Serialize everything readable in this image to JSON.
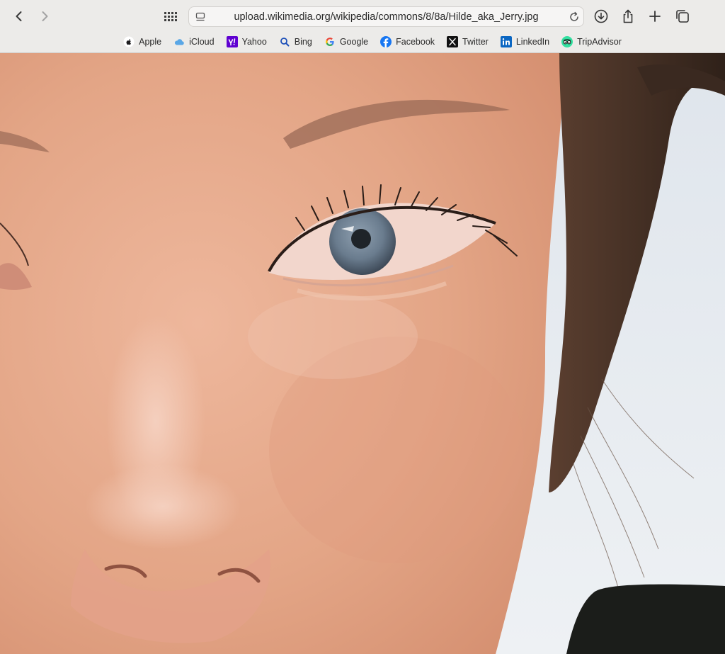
{
  "toolbar": {
    "url": "upload.wikimedia.org/wikipedia/commons/8/8a/Hilde_aka_Jerry.jpg",
    "back_icon": "chevron-left-icon",
    "forward_icon": "chevron-right-icon",
    "tab_grid_icon": "grid-icon",
    "page_icon": "page-settings-icon",
    "reload_icon": "reload-icon",
    "download_icon": "download-icon",
    "share_icon": "share-icon",
    "new_tab_icon": "plus-icon",
    "tabs_overview_icon": "tabs-icon"
  },
  "bookmarks": [
    {
      "label": "Apple",
      "icon": "apple-icon"
    },
    {
      "label": "iCloud",
      "icon": "icloud-icon"
    },
    {
      "label": "Yahoo",
      "icon": "yahoo-icon"
    },
    {
      "label": "Bing",
      "icon": "bing-icon"
    },
    {
      "label": "Google",
      "icon": "google-icon"
    },
    {
      "label": "Facebook",
      "icon": "facebook-icon"
    },
    {
      "label": "Twitter",
      "icon": "twitter-x-icon"
    },
    {
      "label": "LinkedIn",
      "icon": "linkedin-icon"
    },
    {
      "label": "TripAdvisor",
      "icon": "tripadvisor-icon"
    }
  ],
  "colors": {
    "chrome_bg": "#ecebe9",
    "skin": "#e4a88c",
    "hair": "#4a3428",
    "iris": "#6d7f90",
    "sky": "#e3e8ee"
  }
}
